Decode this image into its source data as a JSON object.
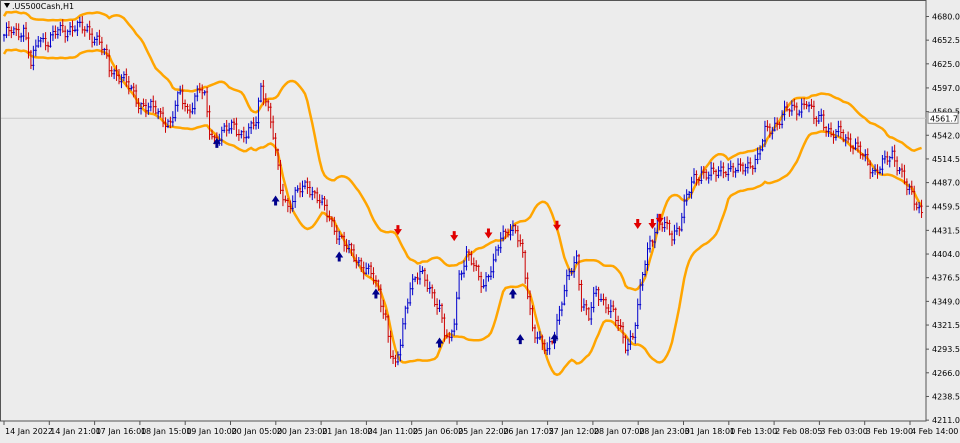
{
  "window": {
    "title": ".US500Cash,H1"
  },
  "price_marker": {
    "value": "4561.7"
  },
  "chart_data": {
    "type": "candlestick",
    "title": ".US500Cash,H1",
    "ylim": [
      4210,
      4698
    ],
    "y_ticks": [
      "4680.0",
      "4652.5",
      "4625.0",
      "4597.0",
      "4569.5",
      "4542.0",
      "4514.5",
      "4487.0",
      "4459.5",
      "4431.5",
      "4404.0",
      "4376.5",
      "4349.0",
      "4321.5",
      "4293.5",
      "4266.0",
      "4238.5",
      "4211.0"
    ],
    "x_ticks": [
      "14 Jan 2022",
      "14 Jan 21:00",
      "17 Jan 16:00",
      "18 Jan 15:00",
      "19 Jan 10:00",
      "20 Jan 05:00",
      "20 Jan 23:00",
      "21 Jan 18:00",
      "24 Jan 11:00",
      "25 Jan 06:00",
      "25 Jan 22:00",
      "26 Jan 17:05",
      "27 Jan 12:00",
      "28 Jan 07:00",
      "28 Jan 23:00",
      "31 Jan 18:00",
      "1 Feb 13:00",
      "2 Feb 08:05",
      "3 Feb 03:00",
      "3 Feb 19:00",
      "4 Feb 14:00"
    ],
    "last_price": 4561.7,
    "colors": {
      "up": "#0000cc",
      "down": "#cc0000",
      "band": "#ffa500",
      "up_arrow": "#00008b",
      "down_arrow": "#e00000"
    },
    "close_anchors": [
      [
        0,
        4655
      ],
      [
        3,
        4665
      ],
      [
        8,
        4663
      ],
      [
        10,
        4640
      ],
      [
        11,
        4620
      ],
      [
        14,
        4658
      ],
      [
        18,
        4650
      ],
      [
        22,
        4663
      ],
      [
        28,
        4667
      ],
      [
        34,
        4665
      ],
      [
        39,
        4650
      ],
      [
        43,
        4620
      ],
      [
        48,
        4610
      ],
      [
        55,
        4580
      ],
      [
        62,
        4570
      ],
      [
        68,
        4555
      ],
      [
        70,
        4575
      ],
      [
        72,
        4590
      ],
      [
        75,
        4570
      ],
      [
        80,
        4595
      ],
      [
        82,
        4585
      ],
      [
        84,
        4550
      ],
      [
        86,
        4538
      ],
      [
        90,
        4545
      ],
      [
        94,
        4555
      ],
      [
        98,
        4540
      ],
      [
        101,
        4548
      ],
      [
        103,
        4560
      ],
      [
        105,
        4600
      ],
      [
        107,
        4585
      ],
      [
        110,
        4540
      ],
      [
        113,
        4480
      ],
      [
        116,
        4460
      ],
      [
        120,
        4475
      ],
      [
        124,
        4485
      ],
      [
        128,
        4470
      ],
      [
        132,
        4450
      ],
      [
        136,
        4430
      ],
      [
        140,
        4410
      ],
      [
        145,
        4395
      ],
      [
        150,
        4380
      ],
      [
        153,
        4360
      ],
      [
        156,
        4330
      ],
      [
        158,
        4290
      ],
      [
        160,
        4270
      ],
      [
        162,
        4300
      ],
      [
        164,
        4340
      ],
      [
        166,
        4370
      ],
      [
        170,
        4380
      ],
      [
        174,
        4365
      ],
      [
        178,
        4340
      ],
      [
        180,
        4310
      ],
      [
        182,
        4300
      ],
      [
        184,
        4330
      ],
      [
        186,
        4380
      ],
      [
        189,
        4400
      ],
      [
        192,
        4390
      ],
      [
        196,
        4370
      ],
      [
        200,
        4390
      ],
      [
        203,
        4425
      ],
      [
        206,
        4435
      ],
      [
        209,
        4430
      ],
      [
        212,
        4400
      ],
      [
        214,
        4360
      ],
      [
        216,
        4320
      ],
      [
        219,
        4300
      ],
      [
        222,
        4290
      ],
      [
        225,
        4315
      ],
      [
        228,
        4350
      ],
      [
        231,
        4380
      ],
      [
        234,
        4400
      ],
      [
        236,
        4350
      ],
      [
        239,
        4330
      ],
      [
        242,
        4360
      ],
      [
        245,
        4350
      ],
      [
        248,
        4340
      ],
      [
        251,
        4320
      ],
      [
        254,
        4300
      ],
      [
        257,
        4310
      ],
      [
        259,
        4340
      ],
      [
        261,
        4380
      ],
      [
        264,
        4420
      ],
      [
        267,
        4440
      ],
      [
        270,
        4435
      ],
      [
        273,
        4425
      ],
      [
        276,
        4440
      ],
      [
        279,
        4470
      ],
      [
        282,
        4490
      ],
      [
        285,
        4500
      ],
      [
        290,
        4495
      ],
      [
        295,
        4505
      ],
      [
        300,
        4500
      ],
      [
        305,
        4510
      ],
      [
        308,
        4515
      ],
      [
        311,
        4545
      ],
      [
        315,
        4555
      ],
      [
        320,
        4570
      ],
      [
        325,
        4575
      ],
      [
        328,
        4580
      ],
      [
        331,
        4560
      ],
      [
        334,
        4565
      ],
      [
        338,
        4540
      ],
      [
        342,
        4545
      ],
      [
        346,
        4535
      ],
      [
        350,
        4520
      ],
      [
        353,
        4510
      ],
      [
        356,
        4500
      ],
      [
        360,
        4510
      ],
      [
        363,
        4520
      ],
      [
        366,
        4505
      ],
      [
        369,
        4480
      ],
      [
        372,
        4465
      ],
      [
        375,
        4455
      ]
    ],
    "up_arrows": [
      [
        87,
        4532
      ],
      [
        111,
        4465
      ],
      [
        137,
        4400
      ],
      [
        152,
        4357
      ],
      [
        178,
        4300
      ],
      [
        208,
        4357
      ],
      [
        211,
        4304
      ],
      [
        225,
        4305
      ]
    ],
    "down_arrows": [
      [
        161,
        4433
      ],
      [
        184,
        4426
      ],
      [
        198,
        4429
      ],
      [
        226,
        4438
      ],
      [
        259,
        4440
      ],
      [
        265,
        4440
      ],
      [
        268,
        4446
      ]
    ]
  }
}
